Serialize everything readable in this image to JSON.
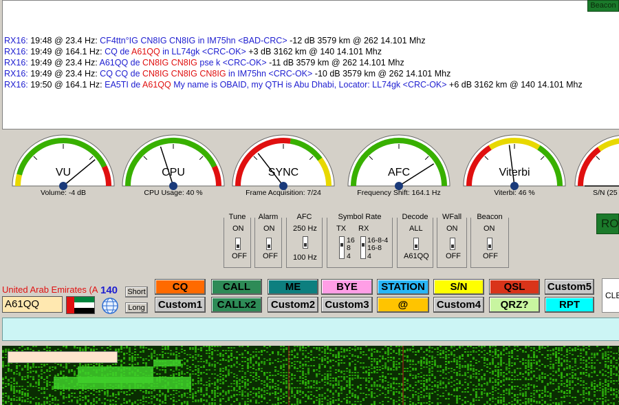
{
  "rx_panel": {
    "beacon_label": "Beacon",
    "lines": [
      {
        "segments": [
          {
            "t": "RX16:",
            "c": "blue"
          },
          {
            "t": " 19:48 @ 23.4 Hz: ",
            "c": "blk"
          },
          {
            "t": "CF4ttn°IG CN8IG  CN8IG in IM75hn  ",
            "c": "blue"
          },
          {
            "t": "<BAD-CRC>",
            "c": "blue"
          },
          {
            "t": " -12 dB  3579 km @ 262  14.101 Mhz",
            "c": "blk"
          }
        ]
      },
      {
        "segments": [
          {
            "t": "RX16:",
            "c": "blue"
          },
          {
            "t": " 19:49 @ 164.1 Hz: ",
            "c": "blk"
          },
          {
            "t": "CQ de ",
            "c": "blue"
          },
          {
            "t": "A61QQ",
            "c": "red"
          },
          {
            "t": " in LL74gk  <CRC-OK>",
            "c": "blue"
          },
          {
            "t": " +3 dB  3162 km @ 140  14.101 Mhz",
            "c": "blk"
          }
        ]
      },
      {
        "segments": [
          {
            "t": "RX16:",
            "c": "blue"
          },
          {
            "t": " 19:49 @ 23.4 Hz: ",
            "c": "blk"
          },
          {
            "t": "A61QQ de ",
            "c": "blue"
          },
          {
            "t": "CN8IG CN8IG",
            "c": "red"
          },
          {
            "t": " pse k  <CRC-OK>",
            "c": "blue"
          },
          {
            "t": " -11 dB  3579 km @ 262  14.101 Mhz",
            "c": "blk"
          }
        ]
      },
      {
        "segments": [
          {
            "t": "RX16:",
            "c": "blue"
          },
          {
            "t": " 19:49 @ 23.4 Hz: ",
            "c": "blk"
          },
          {
            "t": "CQ CQ de ",
            "c": "blue"
          },
          {
            "t": "CN8IG CN8IG",
            "c": "red"
          },
          {
            "t": "  ",
            "c": "blue"
          },
          {
            "t": "CN8IG",
            "c": "red"
          },
          {
            "t": " in IM75hn  <CRC-OK>",
            "c": "blue"
          },
          {
            "t": " -10 dB  3579 km @ 262  14.101 Mhz",
            "c": "blk"
          }
        ]
      },
      {
        "segments": [
          {
            "t": "RX16:",
            "c": "blue"
          },
          {
            "t": " 19:50 @ 164.1 Hz: ",
            "c": "blk"
          },
          {
            "t": "EA5TI de ",
            "c": "blue"
          },
          {
            "t": "A61QQ",
            "c": "red"
          },
          {
            "t": " My name is OBAID, my QTH is Abu Dhabi, Locator: LL74gk  <CRC-OK>",
            "c": "blue"
          },
          {
            "t": " +6 dB  3162 km @ 140  14.101 Mhz",
            "c": "blk"
          }
        ]
      }
    ]
  },
  "gauges": [
    {
      "title": "VU",
      "label": "Volume: -4 dB",
      "level": 0.78,
      "scheme": "vu"
    },
    {
      "title": "CPU",
      "label": "CPU Usage: 40 %",
      "level": 0.4,
      "scheme": "cpu"
    },
    {
      "title": "SYNC",
      "label": "Frame Acquisition: 7/24",
      "level": 0.29,
      "scheme": "sync"
    },
    {
      "title": "AFC",
      "label": "Frequency Shift: 164.1 Hz",
      "level": 0.82,
      "scheme": "afc"
    },
    {
      "title": "Viterbi",
      "label": "Viterbi: 46 %",
      "level": 0.46,
      "scheme": "viterbi"
    },
    {
      "title": "",
      "label": "S/N (25",
      "level": 0.0,
      "scheme": "sn"
    }
  ],
  "controls": {
    "tune": {
      "title": "Tune",
      "on": "ON",
      "off": "OFF"
    },
    "alarm": {
      "title": "Alarm",
      "on": "ON",
      "off": "OFF"
    },
    "afc": {
      "title": "AFC",
      "top": "250 Hz",
      "bottom": "100 Hz"
    },
    "symbol_rate": {
      "title": "Symbol Rate",
      "tx": "TX",
      "rx": "RX",
      "tx_opts": [
        "16",
        "8",
        "4"
      ],
      "rx_opts": [
        "16-8-4",
        "16-8",
        "4"
      ]
    },
    "decode": {
      "title": "Decode",
      "top": "ALL",
      "bottom": "A61QQ"
    },
    "wfall": {
      "title": "WFall",
      "on": "ON",
      "off": "OFF"
    },
    "beacon": {
      "title": "Beacon",
      "on": "ON",
      "off": "OFF"
    },
    "ro_label": "RO"
  },
  "station": {
    "country": "United Arab Emirates (A",
    "distance": "140",
    "callsign": "A61QQ",
    "short_label": "Short",
    "long_label": "Long"
  },
  "macro_buttons": {
    "row1": [
      {
        "label": "CQ",
        "bg": "#ff6a00"
      },
      {
        "label": "CALL",
        "bg": "#2e8b57"
      },
      {
        "label": "ME",
        "bg": "#0d7f7f"
      },
      {
        "label": "BYE",
        "bg": "#ff9ee6"
      },
      {
        "label": "STATION",
        "bg": "#29b6f6"
      },
      {
        "label": "S/N",
        "bg": "#ffff00"
      },
      {
        "label": "QSL",
        "bg": "#d9341a"
      },
      {
        "label": "Custom5",
        "bg": "#c8c8c8"
      }
    ],
    "row2": [
      {
        "label": "Custom1",
        "bg": "#c8c8c8"
      },
      {
        "label": "CALLx2",
        "bg": "#2e8b57"
      },
      {
        "label": "Custom2",
        "bg": "#c8c8c8"
      },
      {
        "label": "Custom3",
        "bg": "#c8c8c8"
      },
      {
        "label": "@",
        "bg": "#ffc400"
      },
      {
        "label": "Custom4",
        "bg": "#c8c8c8"
      },
      {
        "label": "QRZ?",
        "bg": "#c8f5a0"
      },
      {
        "label": "RPT",
        "bg": "#00ffff"
      }
    ],
    "clear_label": "CLE"
  },
  "colors": {
    "rx_blue": "#1d1dd0",
    "rx_red": "#e01010",
    "waterfall_bg": "#0a2d02"
  }
}
